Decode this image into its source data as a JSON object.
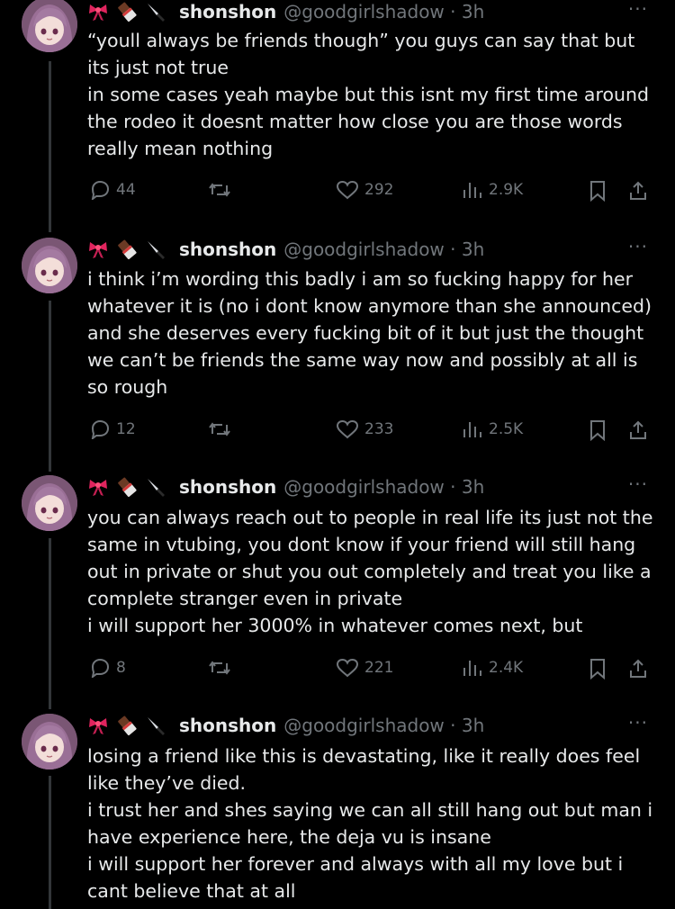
{
  "tweets": [
    {
      "name": "shonshon",
      "handle_time": "@goodgirlshadow · 3h",
      "more": "···",
      "lines": [
        "“youll always be friends though” you guys can say that but",
        "its just not true",
        "in some cases yeah maybe but this isnt my first time around",
        "the rodeo it doesnt matter how close you are those words",
        "really mean nothing"
      ],
      "replies": "44",
      "likes": "292",
      "views": "2.9K"
    },
    {
      "name": "shonshon",
      "handle_time": "@goodgirlshadow · 3h",
      "more": "···",
      "lines": [
        "i think i’m wording this badly i am so fucking happy for her",
        "whatever it is (no i dont know anymore than she announced)",
        "and she deserves every fucking bit of it but just the thought",
        "we can’t be friends the same way now and possibly at all is",
        "so rough"
      ],
      "replies": "12",
      "likes": "233",
      "views": "2.5K"
    },
    {
      "name": "shonshon",
      "handle_time": "@goodgirlshadow · 3h",
      "more": "···",
      "lines": [
        "you can always reach out to people in real life its just not the",
        "same in vtubing, you dont know if your friend will still hang",
        "out in private or shut you out completely and treat you like a",
        "complete stranger even in private",
        "i will support her 3000% in whatever comes next, but"
      ],
      "replies": "8",
      "likes": "221",
      "views": "2.4K"
    },
    {
      "name": "shonshon",
      "handle_time": "@goodgirlshadow · 3h",
      "more": "···",
      "lines": [
        "losing a friend like this is devastating, like it really does feel",
        "like they’ve died.",
        "i trust her and shes saying we can all still hang out but man i",
        "have experience here, the deja vu is insane",
        "i will support her forever and always with all my love but i",
        "cant believe that at all"
      ]
    }
  ],
  "icons": [
    "ribbon-icon",
    "chocolate-icon",
    "knife-icon",
    "reply-icon",
    "retweet-icon",
    "like-icon",
    "views-icon",
    "bookmark-icon",
    "share-icon"
  ],
  "colors": {
    "background": "#000000",
    "text": "#e7e9ea",
    "muted": "#71767b",
    "thread_line": "#333639",
    "ribbon": "#e0245e"
  }
}
